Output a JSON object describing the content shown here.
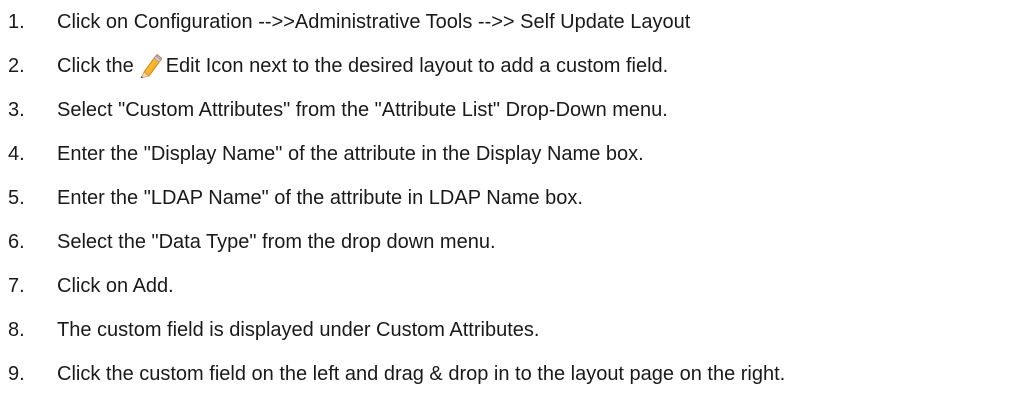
{
  "steps": [
    {
      "number": "1.",
      "text": "Click on Configuration -->>Administrative Tools -->> Self Update Layout"
    },
    {
      "number": "2.",
      "before": "Click the",
      "icon": "pencil-edit-icon",
      "after": "Edit Icon next to the desired layout to add a custom field."
    },
    {
      "number": "3.",
      "text": "Select \"Custom Attributes\" from the \"Attribute List\" Drop-Down menu."
    },
    {
      "number": "4.",
      "text": "Enter the \"Display Name\" of the attribute in the Display Name box."
    },
    {
      "number": "5.",
      "text": "Enter the \"LDAP Name\" of the attribute in LDAP Name box."
    },
    {
      "number": "6.",
      "text": "Select the \"Data Type\" from the drop down menu."
    },
    {
      "number": "7.",
      "text": "Click on Add."
    },
    {
      "number": "8.",
      "text": "The custom field is displayed under Custom Attributes."
    },
    {
      "number": "9.",
      "text": "Click the custom field on the left and drag & drop in to the layout page on the right."
    }
  ]
}
